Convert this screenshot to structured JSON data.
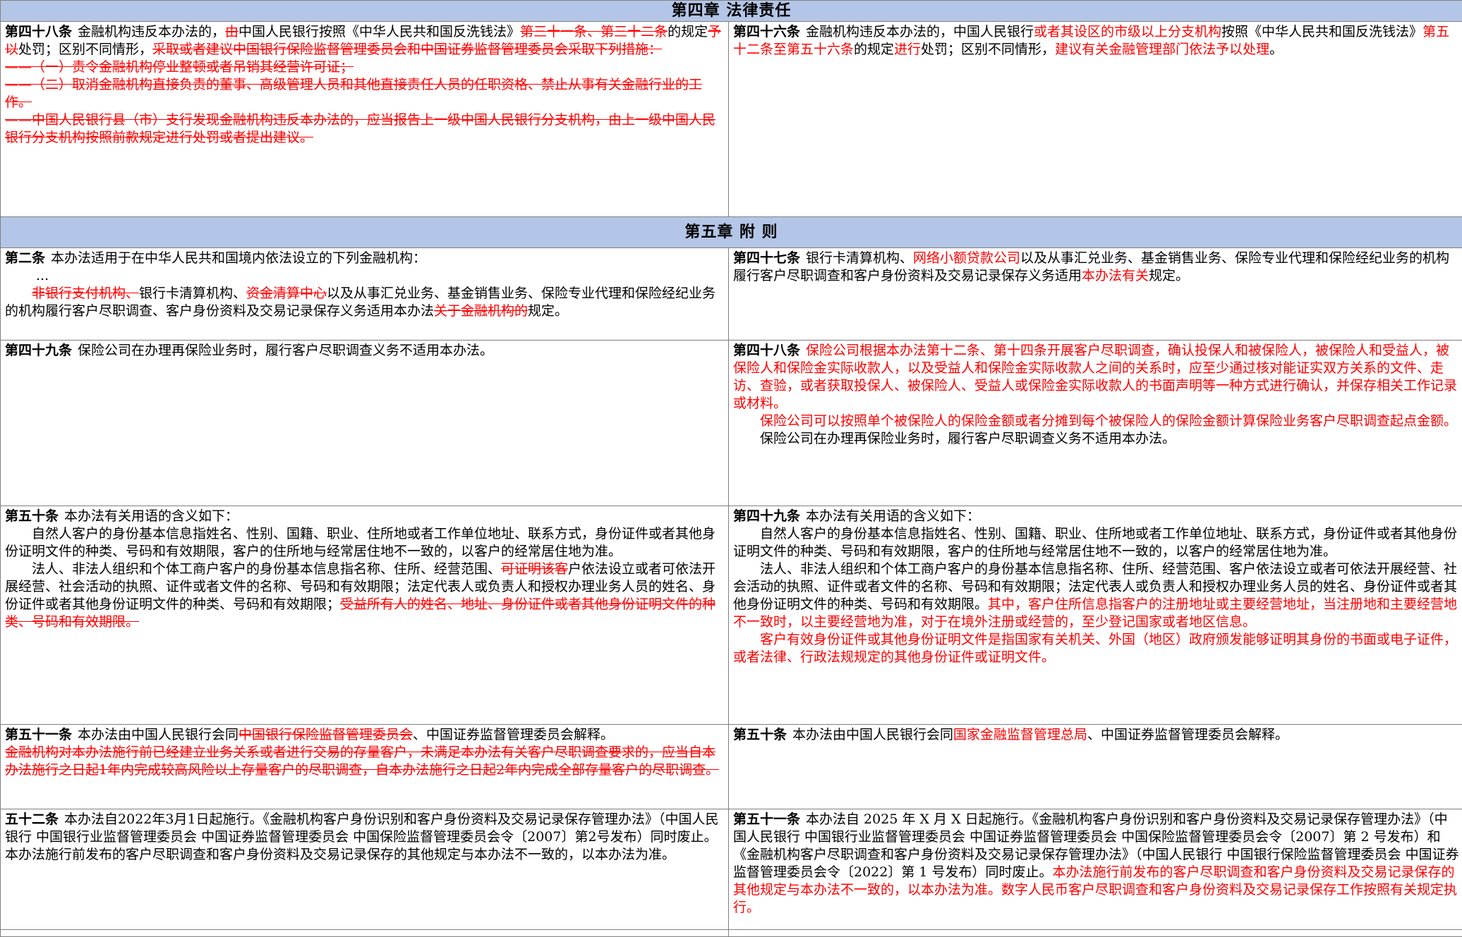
{
  "chapters": {
    "ch4": "第四章  法律责任",
    "ch5": "第五章  附  则"
  },
  "rows": {
    "r1": {
      "left": {
        "article": "第四十八条",
        "p1": [
          {
            "t": "金融机构违反本办法的，"
          },
          {
            "t": "由",
            "s": "del"
          },
          {
            "t": "中国人民银行按照《中华人民共和国反洗钱法》"
          },
          {
            "t": "第三十一条、第三十二条",
            "s": "del"
          },
          {
            "t": "的规定"
          },
          {
            "t": "予以",
            "s": "del"
          },
          {
            "t": "处罚；区别不同情形，"
          },
          {
            "t": "采取或者建议中国银行保险监督管理委员会和中国证券监督管理委员会采取下列措施：",
            "s": "del"
          }
        ],
        "p2": "——（一）责令金融机构停业整顿或者吊销其经营许可证；",
        "p3": "——（二）取消金融机构直接负责的董事、高级管理人员和其他直接责任人员的任职资格、禁止从事有关金融行业的工作。",
        "p4": "——中国人民银行县（市）支行发现金融机构违反本办法的，应当报告上一级中国人民银行分支机构，由上一级中国人民银行分支机构按照前款规定进行处罚或者提出建议。"
      },
      "right": {
        "article": "第四十六条",
        "p1": [
          {
            "t": "金融机构违反本办法的，中国人民银行"
          },
          {
            "t": "或者其设区的市级以上分支机构",
            "s": "ins"
          },
          {
            "t": "按照《中华人民共和国反洗钱法》"
          },
          {
            "t": "第五十二条至第五十六条",
            "s": "ins"
          },
          {
            "t": "的规定"
          },
          {
            "t": "进行",
            "s": "ins"
          },
          {
            "t": "处罚；区别不同情形，"
          },
          {
            "t": "建议有关金融管理部门依法予以处理",
            "s": "ins"
          },
          {
            "t": "。"
          }
        ]
      }
    },
    "r2": {
      "left": {
        "article": "第二条",
        "p1": [
          {
            "t": "本办法适用于在中华人民共和国境内依法设立的下列金融机构："
          }
        ],
        "dots": "...",
        "p2": [
          {
            "t": "非银行支付机构、",
            "s": "del"
          },
          {
            "t": "银行卡清算机构、"
          },
          {
            "t": "资金清算中心",
            "s": "del"
          },
          {
            "t": "以及从事汇兑业务、基金销售业务、保险专业代理和保险经纪业务的机构履行客户尽职调查、客户身份资料及交易记录保存义务适用本办法"
          },
          {
            "t": "关于金融机构的",
            "s": "del"
          },
          {
            "t": "规定。"
          }
        ]
      },
      "right": {
        "article": "第四十七条",
        "p1": [
          {
            "t": "银行卡清算机构、"
          },
          {
            "t": "网络小额贷款公司",
            "s": "ins"
          },
          {
            "t": "以及从事汇兑业务、基金销售业务、保险专业代理和保险经纪业务的机构履行客户尽职调查和客户身份资料及交易记录保存义务适用"
          },
          {
            "t": "本办法有关",
            "s": "ins"
          },
          {
            "t": "规定。"
          }
        ]
      }
    },
    "r3": {
      "left": {
        "article": "第四十九条",
        "p1": [
          {
            "t": "保险公司在办理再保险业务时，履行客户尽职调查义务不适用本办法。"
          }
        ]
      },
      "right": {
        "article": "第四十八条",
        "p1": [
          {
            "t": "保险公司根据本办法第十二条、第十四条开展客户尽职调查，确认投保人和被保险人，被保险人和受益人，被保险人和保险金实际收款人，以及受益人和保险金实际收款人之间的关系时，应至少通过核对能证实双方关系的文件、走访、查验，或者获取投保人、被保险人、受益人或保险金实际收款人的书面声明等一种方式进行确认，并保存相关工作记录或材料。",
            "s": "ins"
          }
        ],
        "p2": [
          {
            "t": "保险公司可以按照单个被保险人的保险金额或者分摊到每个被保险人的保险金额计算保险业务客户尽职调查起点金额。",
            "s": "ins"
          }
        ],
        "p3": "保险公司在办理再保险业务时，履行客户尽职调查义务不适用本办法。"
      }
    },
    "r4": {
      "left": {
        "article": "第五十条",
        "p1": "本办法有关用语的含义如下：",
        "p2": "自然人客户的身份基本信息指姓名、性别、国籍、职业、住所地或者工作单位地址、联系方式，身份证件或者其他身份证明文件的种类、号码和有效期限，客户的住所地与经常居住地不一致的，以客户的经常居住地为准。",
        "p3": [
          {
            "t": "法人、非法人组织和个体工商户客户的身份基本信息指名称、住所、经营范围、"
          },
          {
            "t": "可证明该客",
            "s": "del"
          },
          {
            "t": "户依法设立或者可依法开展经营、社会活动的执照、证件或者文件的名称、号码和有效期限；法定代表人或负责人和授权办理业务人员的姓名、身份证件或者其他身份证明文件的种类、号码和有效期限；"
          },
          {
            "t": "受益所有人的姓名、地址、身份证件或者其他身份证明文件的种类、号码和有效期限。",
            "s": "del"
          }
        ]
      },
      "right": {
        "article": "第四十九条",
        "p1": "本办法有关用语的含义如下：",
        "p2": "自然人客户的身份基本信息指姓名、性别、国籍、职业、住所地或者工作单位地址、联系方式，身份证件或者其他身份证明文件的种类、号码和有效期限，客户的住所地与经常居住地不一致的，以客户的经常居住地为准。",
        "p3": [
          {
            "t": "法人、非法人组织和个体工商户客户的身份基本信息指名称、住所、经营范围、客户依法设立或者可依法开展经营、社会活动的执照、证件或者文件的名称、号码和有效期限；法定代表人或负责人和授权办理业务人员的姓名、身份证件或者其他身份证明文件的种类、号码和有效期限。"
          },
          {
            "t": "其中，客户住所信息指客户的注册地址或主要经营地址，当注册地和主要经营地不一致时，以主要经营地为准，对于在境外注册或经营的，至少登记国家或者地区信息。",
            "s": "ins"
          }
        ],
        "p4": [
          {
            "t": "客户有效身份证件或其他身份证明文件是指国家有关机关、外国（地区）政府颁发能够证明其身份的书面或电子证件，或者法律、行政法规规定的其他身份证件或证明文件。",
            "s": "ins"
          }
        ]
      }
    },
    "r5": {
      "left": {
        "article": "第五十一条",
        "p1": [
          {
            "t": "本办法由中国人民银行会同"
          },
          {
            "t": "中国银行保险监督管理委员会",
            "s": "del"
          },
          {
            "t": "、中国证券监督管理委员会解释。"
          }
        ],
        "p2": [
          {
            "t": "金融机构对本办法施行前已经建立业务关系或者进行交易的存量客户，未满足本办法有关客户尽职调查要求的，应当自本办法施行之日起1年内完成较高风险以上存量客户的尽职调查，自本办法施行之日起2年内完成全部存量客户的尽职调查。",
            "s": "del"
          }
        ]
      },
      "right": {
        "article": "第五十条",
        "p1": [
          {
            "t": "本办法由中国人民银行会同"
          },
          {
            "t": "国家金融监督管理总局",
            "s": "ins"
          },
          {
            "t": "、中国证券监督管理委员会解释。"
          }
        ]
      }
    },
    "r6": {
      "left": {
        "article": "五十二条",
        "p1": [
          {
            "t": "本办法自2022年3月1日起施行。《金融机构客户身份识别和客户身份资料及交易记录保存管理办法》（中国人民银行 中国银行业监督管理委员会 中国证券监督管理委员会 中国保险监督管理委员会令〔2007〕第2号发布）同时废止。本办法施行前发布的客户尽职调查和客户身份资料及交易记录保存的其他规定与本办法不一致的，以本办法为准。"
          }
        ]
      },
      "right": {
        "article": "第五十一条",
        "p1": [
          {
            "t": "本办法自 2025 年 X 月 X 日起施行。《金融机构客户身份识别和客户身份资料及交易记录保存管理办法》（中国人民银行 中国银行业监督管理委员会 中国证券监督管理委员会 中国保险监督管理委员会令〔2007〕第 2 号发布）和《金融机构客户尽职调查和客户身份资料及交易记录保存管理办法》（中国人民银行 中国银行保险监督管理委员会 中国证券监督管理委员会令〔2022〕第 1 号发布）同时废止。"
          },
          {
            "t": "本办法施行前发布的客户尽职调查和客户身份资料及交易记录保存的其他规定与本办法不一致的，以本办法为准。数字人民币客户尽职调查和客户身份资料及交易记录保存工作按照有关规定执行。",
            "s": "ins"
          }
        ]
      }
    }
  }
}
